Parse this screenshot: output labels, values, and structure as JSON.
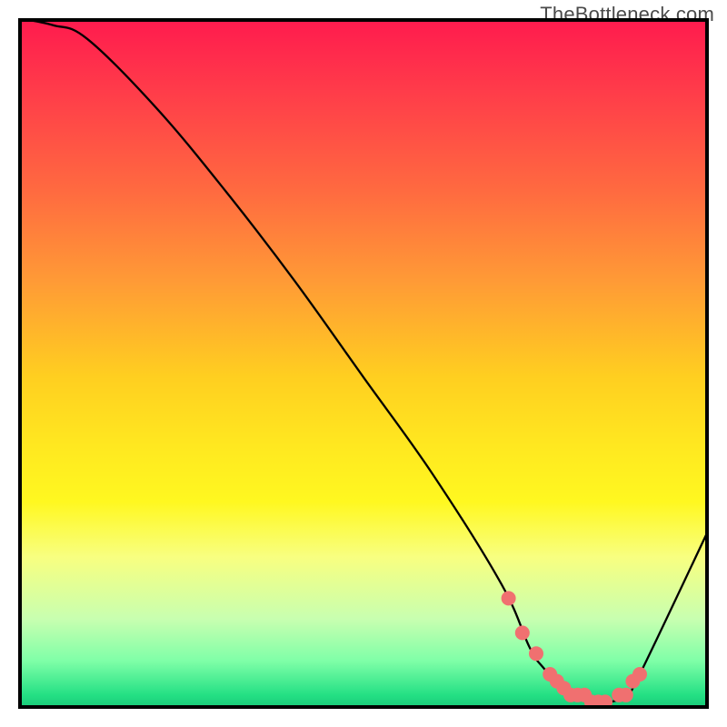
{
  "watermark": "TheBottleneck.com",
  "chart_data": {
    "type": "line",
    "title": "",
    "xlabel": "",
    "ylabel": "",
    "xlim": [
      0,
      100
    ],
    "ylim": [
      0,
      100
    ],
    "grid": false,
    "legend": false,
    "background_gradient": {
      "top_color": "#ff1a4e",
      "bottom_color": "#18c878",
      "note": "red (bottleneck) at top → green (no bottleneck) at bottom"
    },
    "series": [
      {
        "name": "bottleneck-curve",
        "color": "#000000",
        "x": [
          0,
          5,
          10,
          20,
          30,
          40,
          50,
          60,
          70,
          74,
          76,
          80,
          85,
          88,
          90,
          100
        ],
        "values": [
          100,
          99,
          97,
          87,
          75,
          62,
          48,
          34,
          18,
          9,
          6,
          2,
          1,
          2,
          5,
          26
        ]
      }
    ],
    "highlight_points": {
      "name": "optimal-range",
      "color": "#f07070",
      "x": [
        71,
        73,
        75,
        77,
        78,
        79,
        80,
        81,
        82,
        83,
        84,
        85,
        87,
        88,
        89,
        90
      ],
      "values": [
        16,
        11,
        8,
        5,
        4,
        3,
        2,
        2,
        2,
        1,
        1,
        1,
        2,
        2,
        4,
        5
      ]
    }
  }
}
